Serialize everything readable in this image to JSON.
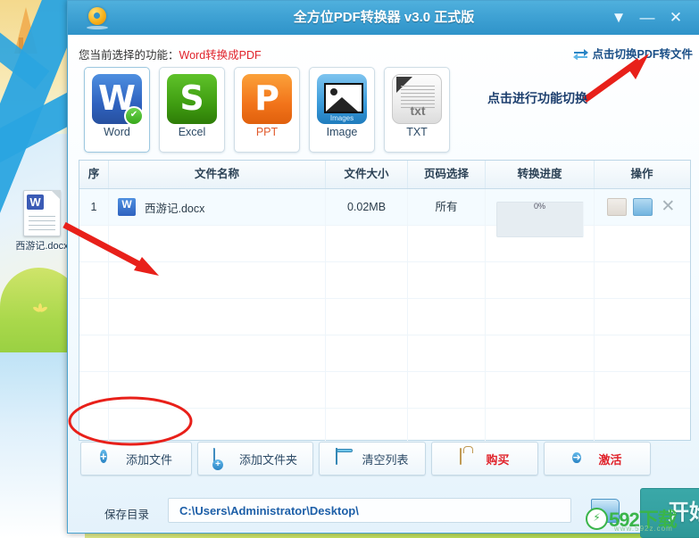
{
  "window": {
    "title": "全方位PDF转换器 v3.0 正式版",
    "logo_icon": "app-logo-icon",
    "controls": {
      "skin_label": "▼",
      "minimize_label": "—",
      "close_label": "✕"
    }
  },
  "function_bar": {
    "prefix": "您当前选择的功能：",
    "current": "Word转换成PDF",
    "switch_link": "点击切换PDF转文件",
    "swap_icon": "swap-arrows-icon"
  },
  "formats": [
    {
      "name": "Word",
      "icon": "word-icon",
      "glyph": "W",
      "selected": true,
      "check": "✔"
    },
    {
      "name": "Excel",
      "icon": "excel-icon",
      "glyph": "S",
      "selected": false,
      "check": ""
    },
    {
      "name": "PPT",
      "icon": "ppt-icon",
      "glyph": "P",
      "selected": false,
      "check": ""
    },
    {
      "name": "Image",
      "icon": "image-icon",
      "glyph": "",
      "caption": "Images",
      "selected": false,
      "check": ""
    },
    {
      "name": "TXT",
      "icon": "txt-icon",
      "glyph": "",
      "caption": "txt",
      "selected": false,
      "check": ""
    }
  ],
  "table": {
    "headers": [
      "序",
      "文件名称",
      "文件大小",
      "页码选择",
      "转换进度",
      "操作"
    ],
    "rows": [
      {
        "index": "1",
        "filename": "西游记.docx",
        "file_icon": "word-file-icon",
        "file_icon_glyph": "W",
        "size": "0.02MB",
        "pages": "所有",
        "progress": "0%",
        "actions": [
          "send-mail-icon",
          "open-folder-icon",
          "remove-icon"
        ],
        "remove_glyph": "✕"
      }
    ],
    "empty_rows": 6
  },
  "buttons": [
    {
      "label": "添加文件",
      "icon": "add-file-icon",
      "red": false
    },
    {
      "label": "添加文件夹",
      "icon": "add-folder-icon",
      "red": false
    },
    {
      "label": "清空列表",
      "icon": "clear-list-icon",
      "red": false
    },
    {
      "label": "购买",
      "icon": "buy-bag-icon",
      "red": true
    },
    {
      "label": "激活",
      "icon": "activate-icon",
      "red": true
    }
  ],
  "save": {
    "label": "保存目录",
    "path": "C:\\Users\\Administrator\\Desktop\\",
    "browse_icon": "browse-folder-icon",
    "start_label": "开始"
  },
  "annotations": {
    "switch_hint": "点击进行功能切换",
    "arrow_to_switch": "red-arrow-icon",
    "arrow_to_table": "red-arrow-icon",
    "circle_add_file": "red-ellipse-highlight"
  },
  "desktop": {
    "file_name": "西游记.docx",
    "file_icon": "word-document-icon",
    "file_glyph": "W"
  },
  "watermark": {
    "text": "592下载",
    "sub": "www.592z.com",
    "badge": "⚡",
    "color": "#3ab54a"
  }
}
